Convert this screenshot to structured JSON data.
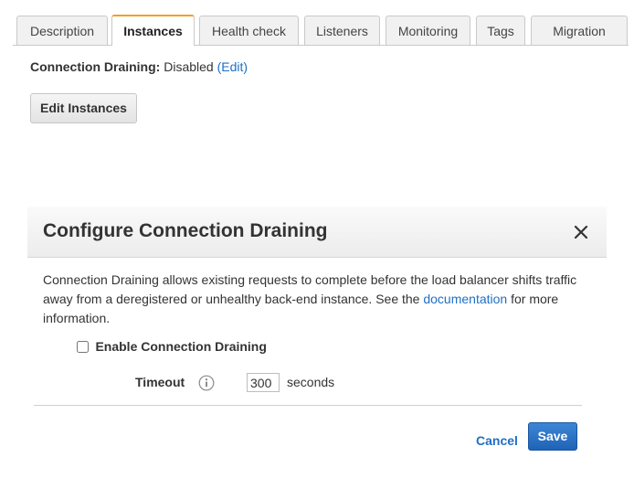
{
  "tabs": [
    {
      "label": "Description",
      "active": false
    },
    {
      "label": "Instances",
      "active": true
    },
    {
      "label": "Health check",
      "active": false
    },
    {
      "label": "Listeners",
      "active": false
    },
    {
      "label": "Monitoring",
      "active": false
    },
    {
      "label": "Tags",
      "active": false
    },
    {
      "label": "Migration",
      "active": false
    }
  ],
  "draining": {
    "label": "Connection Draining:",
    "value": "Disabled",
    "edit_link": "(Edit)"
  },
  "edit_instances_label": "Edit Instances",
  "modal": {
    "title": "Configure Connection Draining",
    "close_icon": "close-icon",
    "description_before_link": "Connection Draining allows existing requests to complete before the load balancer shifts traffic away from a deregistered or unhealthy back-end instance. See the ",
    "documentation_link": "documentation",
    "description_after_link": " for more information.",
    "enable_label": "Enable Connection Draining",
    "enable_checked": false,
    "timeout_label": "Timeout",
    "info_icon": "info-icon",
    "timeout_value": "300",
    "timeout_unit": "seconds",
    "cancel_label": "Cancel",
    "save_label": "Save"
  },
  "colors": {
    "link": "#1f6fc5",
    "active_tab_accent": "#f0a026",
    "primary_button": "#2a6fc2"
  }
}
